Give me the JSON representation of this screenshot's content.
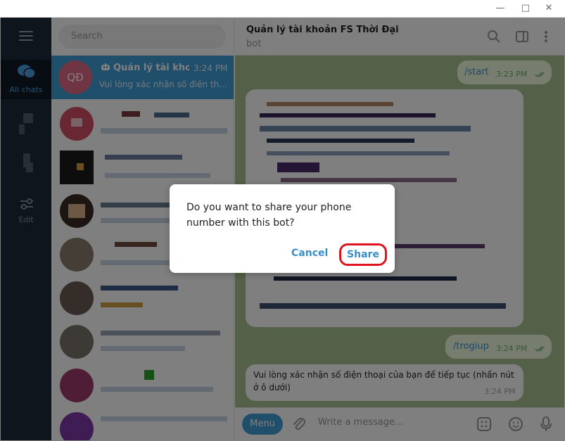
{
  "window": {
    "minimize_icon": "minimize-icon",
    "maximize_icon": "maximize-icon",
    "close_icon": "close-icon"
  },
  "sidebar": {
    "all_chats_label": "All chats",
    "edit_label": "Edit"
  },
  "search": {
    "placeholder": "Search"
  },
  "active_chat": {
    "avatar_initials": "QĐ",
    "name": "Quản lý tài kho...",
    "time": "3:24 PM",
    "preview": "Vui lòng xác nhận số điện th..."
  },
  "header": {
    "title": "Quản lý tài khoản FS Thời Đại",
    "subtitle": "bot"
  },
  "messages": {
    "start_cmd": "/start",
    "start_time": "3:23 PM",
    "trogiup_cmd": "/trogiup",
    "trogiup_time": "3:24 PM",
    "confirm_text": "Vui lòng xác nhận số điện thoại của bạn để tiếp tục (nhấn nút ở ô dưới)",
    "confirm_time": "3:24 PM"
  },
  "input": {
    "menu_label": "Menu",
    "placeholder": "Write a message..."
  },
  "dialog": {
    "text": "Do you want to share your phone number with this bot?",
    "cancel_label": "Cancel",
    "share_label": "Share"
  },
  "colors": {
    "accent": "#419fd9",
    "highlight": "#e0141e",
    "sidebar": "#1c2a3a"
  }
}
